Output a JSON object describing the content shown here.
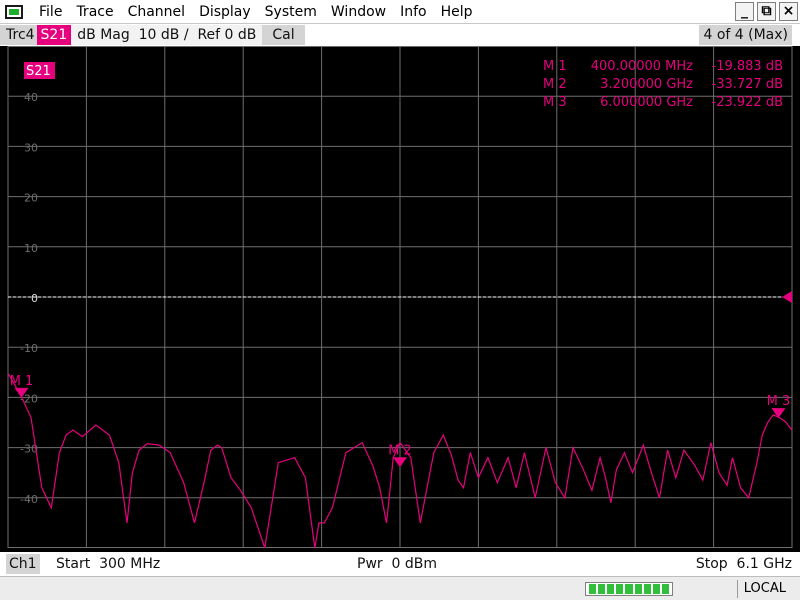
{
  "menubar": {
    "items": [
      "File",
      "Trace",
      "Channel",
      "Display",
      "System",
      "Window",
      "Info",
      "Help"
    ],
    "minimize": "_",
    "restore": "⧉",
    "close": "×"
  },
  "trace": {
    "name": "Trc4",
    "param": "S21",
    "format": "dB Mag  10 dB /  Ref 0 dB",
    "cal": "Cal",
    "count": "4 of 4 (Max)"
  },
  "plot": {
    "trace_label": "S21",
    "ref_value": "0",
    "markers": [
      {
        "id": "M 1",
        "freq": "400.00000 MHz",
        "value": "-19.883 dB",
        "x_ghz": 0.4,
        "y_db": -19.883
      },
      {
        "id": "M 2",
        "freq": "3.200000 GHz",
        "value": "-33.727 dB",
        "x_ghz": 3.2,
        "y_db": -33.727
      },
      {
        "id": "M 3",
        "freq": "6.000000 GHz",
        "value": "-23.922 dB",
        "x_ghz": 6.0,
        "y_db": -23.922
      }
    ],
    "y_ticks": [
      "40",
      "30",
      "20",
      "10",
      "0",
      "-10",
      "-20",
      "-30",
      "-40"
    ],
    "colors": {
      "trace": "#e6007e",
      "grid": "#6e6e6e",
      "tick_label": "#6e6e6e",
      "ref_line": "#ffffff"
    }
  },
  "chart_data": {
    "type": "line",
    "xlim": [
      0.3,
      6.1
    ],
    "ylim": [
      -50,
      50
    ],
    "grid": true,
    "series": [
      {
        "name": "S21",
        "x": [
          0.3,
          0.35,
          0.4,
          0.47,
          0.55,
          0.62,
          0.68,
          0.73,
          0.78,
          0.85,
          0.95,
          1.05,
          1.12,
          1.18,
          1.22,
          1.27,
          1.33,
          1.42,
          1.5,
          1.6,
          1.68,
          1.75,
          1.8,
          1.85,
          1.88,
          1.91,
          1.95,
          2.02,
          2.1,
          2.2,
          2.3,
          2.42,
          2.5,
          2.57,
          2.6,
          2.64,
          2.7,
          2.8,
          2.92,
          3.0,
          3.05,
          3.1,
          3.12,
          3.15,
          3.2,
          3.28,
          3.35,
          3.45,
          3.52,
          3.58,
          3.63,
          3.67,
          3.72,
          3.78,
          3.85,
          3.92,
          4.0,
          4.06,
          4.12,
          4.2,
          4.28,
          4.35,
          4.42,
          4.48,
          4.55,
          4.62,
          4.68,
          4.72,
          4.76,
          4.8,
          4.86,
          4.92,
          5.0,
          5.06,
          5.12,
          5.18,
          5.24,
          5.3,
          5.38,
          5.44,
          5.5,
          5.56,
          5.62,
          5.66,
          5.72,
          5.78,
          5.84,
          5.88,
          5.92,
          5.96,
          6.0,
          6.05,
          6.1
        ],
        "y": [
          -15.2,
          -17.5,
          -19.9,
          -24.0,
          -38.0,
          -42.0,
          -31.0,
          -27.5,
          -26.5,
          -27.8,
          -25.5,
          -27.5,
          -33.0,
          -45.0,
          -35.0,
          -30.5,
          -29.2,
          -29.5,
          -31.0,
          -37.0,
          -45.0,
          -37.0,
          -30.5,
          -29.5,
          -30.0,
          -32.5,
          -36.0,
          -38.5,
          -42.0,
          -50.0,
          -33.0,
          -32.0,
          -36.0,
          -50.0,
          -45.0,
          -45.0,
          -42.0,
          -31.0,
          -29.0,
          -33.7,
          -38.0,
          -45.0,
          -40.0,
          -32.0,
          -29.0,
          -32.0,
          -45.0,
          -31.0,
          -27.5,
          -31.5,
          -36.5,
          -38.0,
          -31.0,
          -36.0,
          -32.0,
          -37.0,
          -32.0,
          -38.0,
          -31.0,
          -40.0,
          -30.0,
          -37.0,
          -40.0,
          -30.0,
          -34.0,
          -38.5,
          -32.0,
          -36.0,
          -41.0,
          -34.5,
          -31.0,
          -35.0,
          -29.5,
          -35.0,
          -40.0,
          -30.5,
          -36.0,
          -30.5,
          -33.5,
          -36.5,
          -29.0,
          -35.0,
          -37.5,
          -32.0,
          -38.0,
          -40.0,
          -33.0,
          -27.5,
          -25.0,
          -23.5,
          -23.9,
          -24.8,
          -26.5
        ]
      }
    ]
  },
  "channel": {
    "name": "Ch1",
    "start": "Start  300 MHz",
    "pwr": "Pwr  0 dBm",
    "stop": "Stop  6.1 GHz"
  },
  "status": {
    "progress_segments": 9,
    "local": "LOCAL"
  }
}
